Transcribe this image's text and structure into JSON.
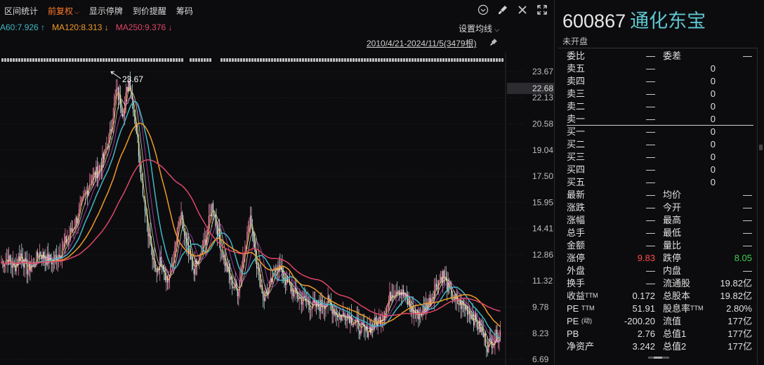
{
  "toolbar": {
    "items": [
      "区间统计",
      "前复权",
      "显示停牌",
      "到价提醒",
      "筹码"
    ],
    "active_index": 1
  },
  "ma_legend": {
    "ma60": "A60:7.926 ↑",
    "ma120": "MA120:8.313 ↓",
    "ma250": "MA250:9.376 ↓"
  },
  "set_ma_label": "设置均线",
  "date_range": "2010/4/21-2024/11/5(3479根)",
  "chart_data": {
    "type": "candlestick",
    "y_axis_labels": [
      "23.67",
      "22.13",
      "20.58",
      "19.04",
      "17.50",
      "15.95",
      "14.41",
      "12.86",
      "11.32",
      "9.78",
      "8.23",
      "6.69"
    ],
    "current_price_label": "22.68",
    "max_annotation": "23.67",
    "ylim": [
      6.69,
      23.67
    ],
    "series": [
      {
        "name": "MA60",
        "color": "#3fb8c4"
      },
      {
        "name": "MA120",
        "color": "#f09a2a"
      },
      {
        "name": "MA250",
        "color": "#e0456a"
      }
    ],
    "close_trace": [
      12.4,
      12.6,
      12.1,
      12.9,
      12.0,
      12.3,
      13.0,
      12.6,
      12.5,
      12.9,
      13.6,
      14.3,
      15.2,
      16.3,
      17.3,
      17.8,
      18.6,
      20.0,
      22.6,
      21.3,
      23.2,
      20.6,
      17.0,
      14.2,
      11.8,
      12.6,
      11.2,
      12.8,
      15.2,
      13.2,
      12.0,
      12.6,
      13.9,
      15.9,
      13.9,
      12.3,
      11.2,
      10.7,
      13.3,
      15.0,
      12.1,
      10.3,
      11.0,
      12.4,
      11.6,
      11.0,
      10.5,
      10.2,
      10.0,
      9.8,
      9.9,
      10.1,
      9.6,
      9.2,
      9.4,
      9.0,
      8.6,
      8.3,
      8.7,
      9.0,
      9.6,
      10.6,
      10.9,
      10.4,
      9.7,
      9.3,
      9.6,
      10.2,
      11.1,
      11.7,
      10.7,
      10.1,
      9.9,
      9.6,
      9.0,
      8.4,
      7.5,
      7.9,
      8.3
    ]
  },
  "quote": {
    "code": "600867",
    "name": "通化东宝",
    "status": "未开盘",
    "top_row": {
      "l1": "委比",
      "v1": "—",
      "l2": "委差",
      "v2": "—"
    },
    "sells": [
      {
        "label": "卖五",
        "price": "—",
        "vol": "0"
      },
      {
        "label": "卖四",
        "price": "—",
        "vol": "0"
      },
      {
        "label": "卖三",
        "price": "—",
        "vol": "0"
      },
      {
        "label": "卖二",
        "price": "—",
        "vol": "0"
      },
      {
        "label": "卖一",
        "price": "—",
        "vol": "0"
      }
    ],
    "buys": [
      {
        "label": "买一",
        "price": "—",
        "vol": "0"
      },
      {
        "label": "买二",
        "price": "—",
        "vol": "0"
      },
      {
        "label": "买三",
        "price": "—",
        "vol": "0"
      },
      {
        "label": "买四",
        "price": "—",
        "vol": "0"
      },
      {
        "label": "买五",
        "price": "—",
        "vol": "0"
      }
    ],
    "stats": [
      {
        "l1": "最新",
        "v1": "—",
        "l2": "均价",
        "v2": "—"
      },
      {
        "l1": "涨跌",
        "v1": "—",
        "l2": "今开",
        "v2": "—"
      },
      {
        "l1": "涨幅",
        "v1": "—",
        "l2": "最高",
        "v2": "—"
      },
      {
        "l1": "总手",
        "v1": "—",
        "l2": "最低",
        "v2": "—"
      },
      {
        "l1": "金额",
        "v1": "—",
        "l2": "量比",
        "v2": "—"
      },
      {
        "l1": "涨停",
        "v1": "9.83",
        "l2": "跌停",
        "v2": "8.05"
      },
      {
        "l1": "外盘",
        "v1": "—",
        "l2": "内盘",
        "v2": "—"
      },
      {
        "l1": "换手",
        "v1": "—",
        "l2": "流通股",
        "v2": "19.82亿"
      },
      {
        "l1": "收益",
        "l1sup": "TTM",
        "v1": "0.172",
        "l2": "总股本",
        "v2": "19.82亿"
      },
      {
        "l1": "PE ",
        "l1sup": "TTM",
        "v1": "51.91",
        "l2": "股息率",
        "l2sup": "TTM",
        "v2": "2.80%"
      },
      {
        "l1": "PE ",
        "l1sup": "(动)",
        "v1": "-200.20",
        "l2": "流值",
        "v2": "177亿"
      },
      {
        "l1": "PB",
        "v1": "2.76",
        "l2": "总值1",
        "v2": "177亿"
      },
      {
        "l1": "净资产",
        "v1": "3.242",
        "l2": "总值2",
        "v2": "177亿"
      }
    ],
    "colors": {
      "limit_up": "#ff4a4a",
      "limit_down": "#3fcf4a"
    }
  }
}
